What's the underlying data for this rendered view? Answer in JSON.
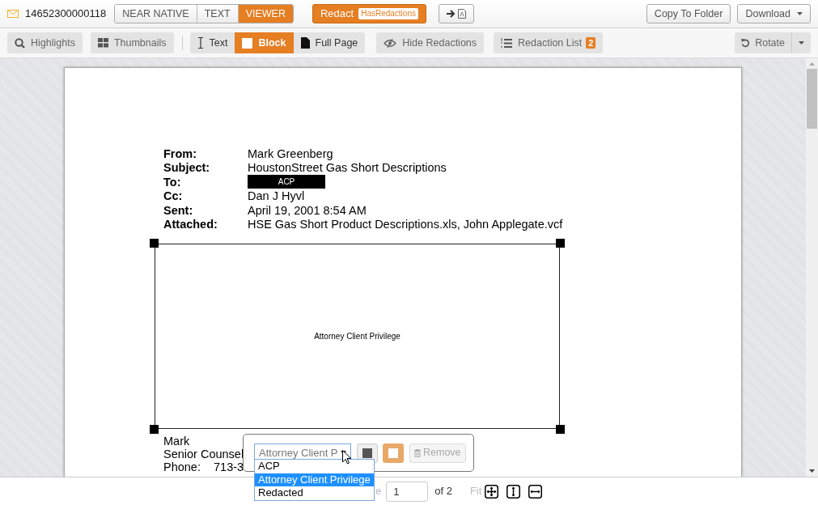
{
  "record": {
    "id": "14652300000118"
  },
  "view_modes": [
    {
      "label": "NEAR NATIVE",
      "selected": false
    },
    {
      "label": "TEXT",
      "selected": false
    },
    {
      "label": "VIEWER",
      "selected": true
    }
  ],
  "redact_button": {
    "label": "Redact",
    "badge": "HasRedactions"
  },
  "top_actions": [
    {
      "label": "Copy To Folder",
      "kind": "button"
    },
    {
      "label": "Download",
      "kind": "dropdown"
    }
  ],
  "toolbar": {
    "highlights": "Highlights",
    "thumbnails": "Thumbnails",
    "redaction_modes": [
      {
        "label": "Text",
        "kind": "text",
        "selected": false
      },
      {
        "label": "Block",
        "kind": "block",
        "selected": true
      },
      {
        "label": "Full Page",
        "kind": "page",
        "selected": false
      }
    ],
    "hide_redactions": "Hide Redactions",
    "redaction_list": {
      "label": "Redaction List",
      "count": "2"
    },
    "rotate": "Rotate"
  },
  "document": {
    "header_fields": [
      {
        "label": "From:",
        "value": "Mark Greenberg"
      },
      {
        "label": "Subject:",
        "value": "HoustonStreet Gas Short Descriptions"
      },
      {
        "label": "To:",
        "redaction": "ACP"
      },
      {
        "label": "Cc:",
        "value": "Dan J Hyvl"
      },
      {
        "label": "Sent:",
        "value": "April 19, 2001 8:54 AM"
      },
      {
        "label": "Attached:",
        "value": "HSE Gas Short Product Descriptions.xls, John Applegate.vcf"
      }
    ],
    "redaction_box": {
      "label": "Attorney Client Privilege"
    },
    "signature_lines": [
      {
        "label": "Mark"
      },
      {
        "label": "Senior Counsel,"
      },
      {
        "label": "Phone:",
        "value": "713-3"
      }
    ]
  },
  "redaction_popup": {
    "select_value": "Attorney Client P",
    "fill_options": [
      {
        "kind": "black",
        "selected": false
      },
      {
        "kind": "white",
        "selected": true
      }
    ],
    "remove": {
      "label": "Remove",
      "disabled": true
    },
    "options": [
      {
        "label": "ACP",
        "selected": false
      },
      {
        "label": "Attorney Client Privilege",
        "selected": true
      },
      {
        "label": "Redacted",
        "selected": false
      }
    ]
  },
  "pager": {
    "label": "e",
    "page": "1",
    "total": "of 2",
    "fit": "Fit"
  }
}
